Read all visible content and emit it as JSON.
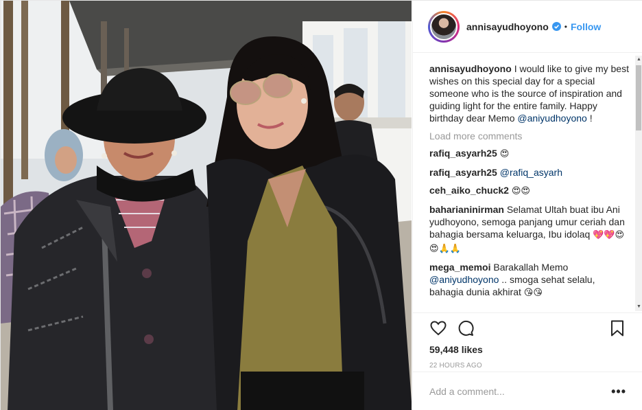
{
  "post": {
    "photo_alt": "Two women posing on a boardwalk"
  },
  "header": {
    "username": "annisayudhoyono",
    "separator": "•",
    "follow_label": "Follow",
    "verified_color": "#3897f0"
  },
  "caption": {
    "username": "annisayudhoyono",
    "text_main": "I would like to give my best wishes on this special day for a special someone who is the source of inspiration and guiding light for the entire family. Happy birthday dear Memo ",
    "mention": "@aniyudhoyono",
    "text_end": " !"
  },
  "load_more_label": "Load more comments",
  "comments": [
    {
      "username": "rafiq_asyarh25",
      "text": " ",
      "emoji": "😍"
    },
    {
      "username": "rafiq_asyarh25",
      "text": " ",
      "mention": "@rafiq_asyarh"
    },
    {
      "username": "ceh_aiko_chuck2",
      "text": " ",
      "emoji": "😍😍"
    },
    {
      "username": "baharianinirman",
      "text": " Selamat Ultah buat ibu Ani yudhoyono, semoga panjang umur ceriah dan bahagia bersama keluarga, Ibu idolaq",
      "emoji": "💖💖😍😍🙏🙏"
    },
    {
      "username": "mega_memoi",
      "text": " Barakallah Memo ",
      "mention": "@aniyudhoyono",
      "text_end": " .. smoga sehat selalu, bahagia dunia akhirat ",
      "emoji": "😘😘"
    }
  ],
  "actions": {
    "like_icon": "heart-icon",
    "comment_icon": "comment-icon",
    "save_icon": "bookmark-icon",
    "likes": "59,448 likes",
    "timestamp": "22 HOURS AGO"
  },
  "add_comment": {
    "placeholder": "Add a comment...",
    "more_icon": "•••"
  },
  "colors": {
    "link": "#003569",
    "follow": "#3897f0",
    "muted": "#999999",
    "border": "#efefef"
  }
}
